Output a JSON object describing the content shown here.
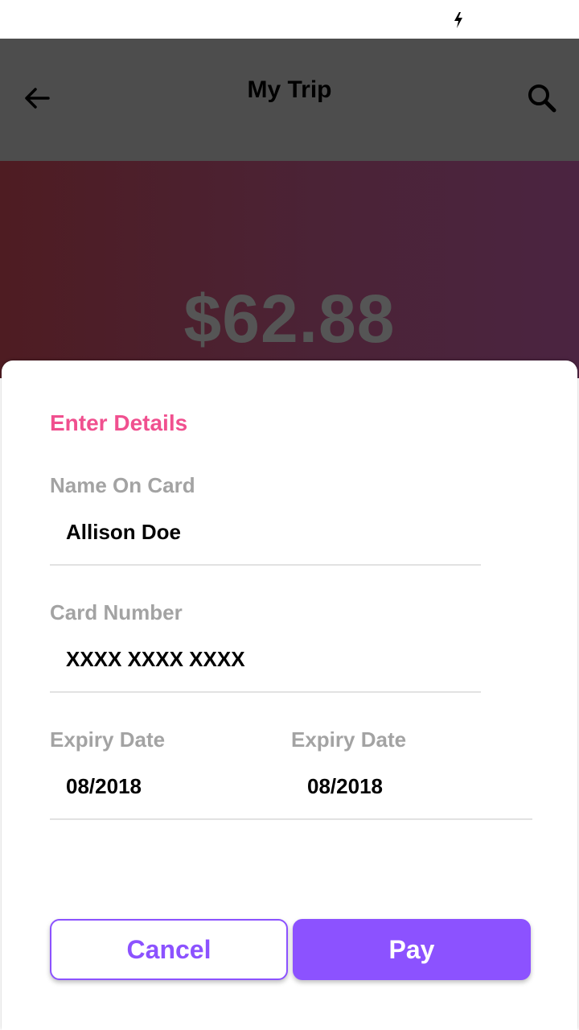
{
  "app_bar": {
    "title": "My Trip",
    "back_icon": "arrow-left-icon",
    "search_icon": "search-icon"
  },
  "status_bar": {
    "charging_icon": "lightning-bolt-icon"
  },
  "trip": {
    "amount": "$62.88"
  },
  "form": {
    "section_title": "Enter Details",
    "name_label": "Name On Card",
    "name_value": "Allison Doe",
    "card_label": "Card Number",
    "card_value": "XXXX XXXX XXXX",
    "expiry_label_1": "Expiry Date",
    "expiry_value_1": "08/2018",
    "expiry_label_2": "Expiry Date",
    "expiry_value_2": "08/2018"
  },
  "actions": {
    "cancel_label": "Cancel",
    "pay_label": "Pay"
  },
  "colors": {
    "accent": "#8c52ff",
    "section_title": "#f0508f",
    "app_bar": "#4d4d4d",
    "label": "#a3a3a3"
  }
}
